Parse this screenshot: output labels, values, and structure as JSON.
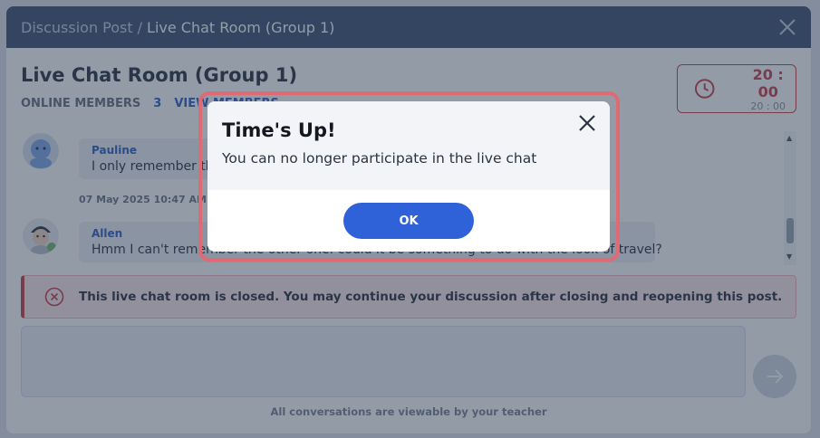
{
  "header": {
    "breadcrumb_parent": "Discussion Post",
    "breadcrumb_separator": "/",
    "breadcrumb_current": "Live Chat Room (Group 1)"
  },
  "room": {
    "title": "Live Chat Room (Group 1)",
    "online_members_label": "ONLINE MEMBERS",
    "online_members_count": "3",
    "view_members_label": "VIEW MEMBERS"
  },
  "timer": {
    "remaining": "20 : 00",
    "total": "20 : 00",
    "icon": "clock-icon"
  },
  "messages": [
    {
      "author": "Pauline",
      "text": "I only remember the",
      "timestamp": "07 May 2025 10:47 AM"
    },
    {
      "author": "Allen",
      "text": "Hmm I can't remember the other one. could it be something to do with the look of travel?"
    }
  ],
  "banner": {
    "text": "This live chat room is closed. You may continue your discussion after closing and reopening this post."
  },
  "footer": {
    "note": "All conversations are viewable by your teacher"
  },
  "dialog": {
    "title": "Time's Up!",
    "message": "You can no longer participate in the live chat",
    "ok_label": "OK"
  },
  "colors": {
    "header": "#3f5372",
    "accent": "#2f62d8",
    "danger": "#c9404a",
    "dialog_outline": "#e06a72"
  }
}
